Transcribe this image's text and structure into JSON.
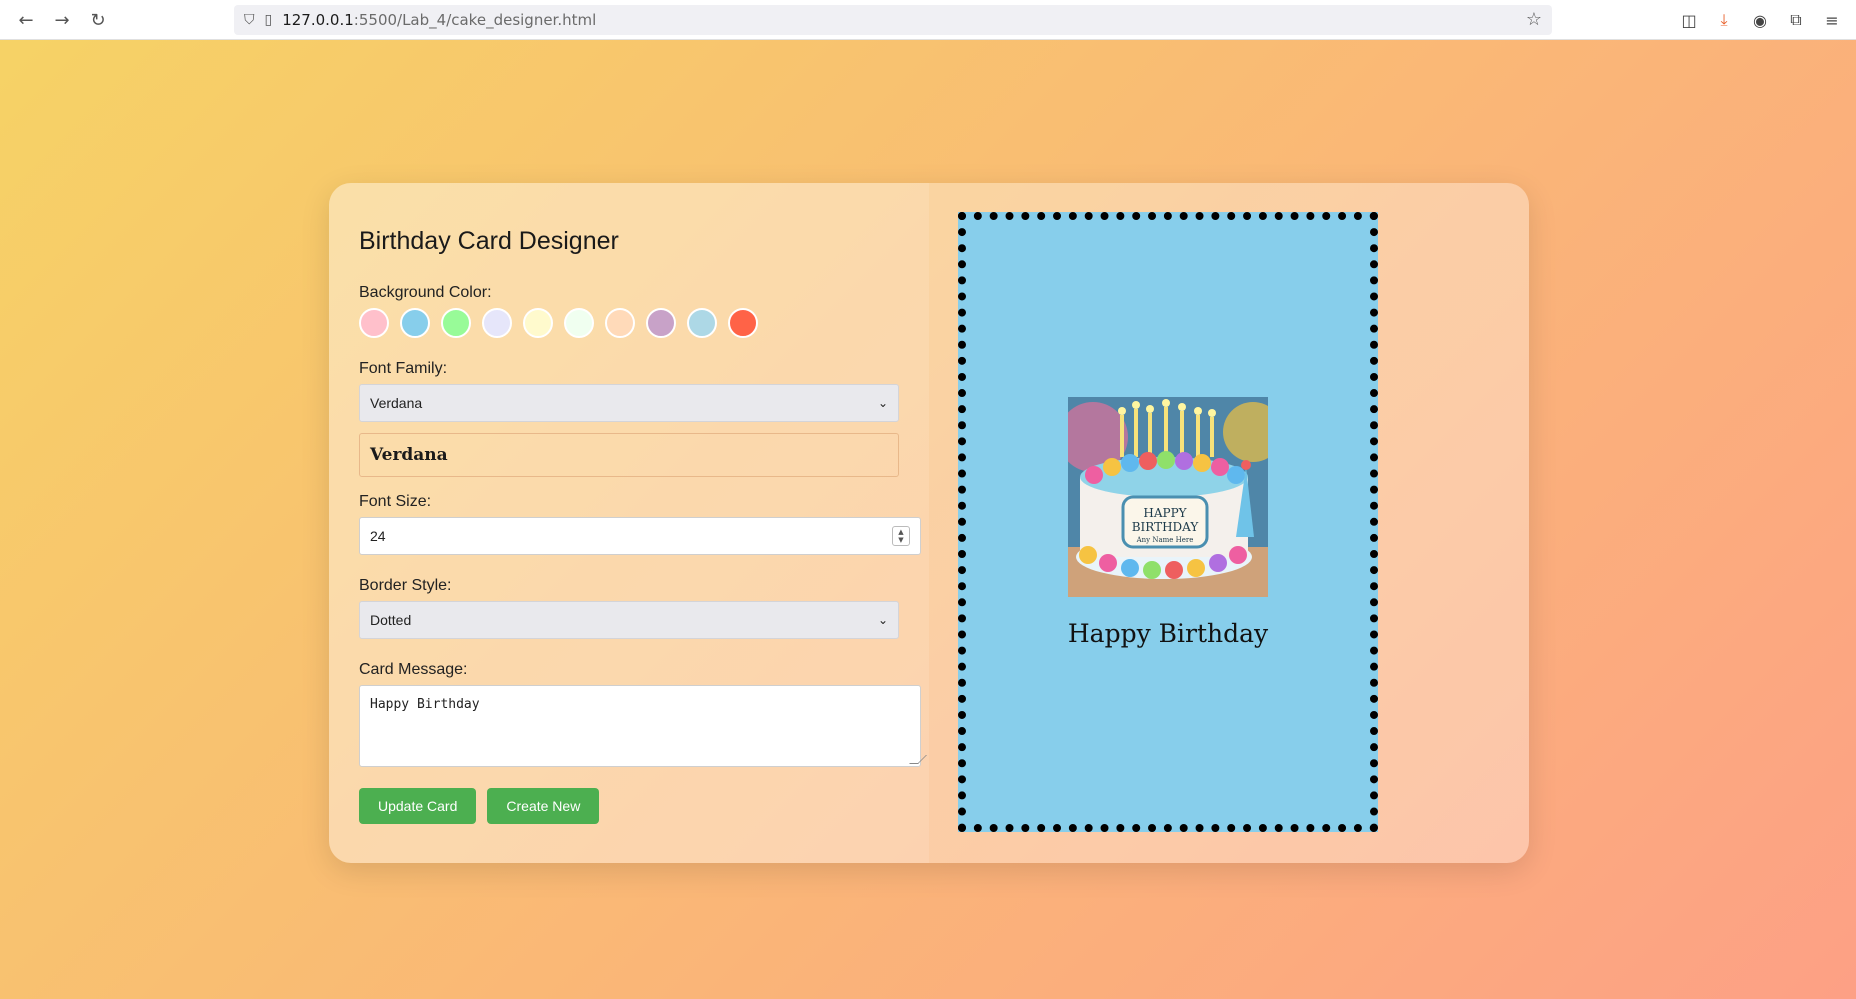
{
  "browser": {
    "url_host": "127.0.0.1",
    "url_path": ":5500/Lab_4/cake_designer.html"
  },
  "designer": {
    "title": "Birthday Card Designer",
    "background_color_label": "Background Color:",
    "swatches": [
      "#ffc0cb",
      "#87ceeb",
      "#98fb98",
      "#e6e6fa",
      "#fffacd",
      "#f0fff0",
      "#ffdab9",
      "#c8a2c8",
      "#add8e6",
      "#ff6347"
    ],
    "font_family_label": "Font Family:",
    "font_family_value": "Verdana",
    "font_preview_text": "Verdana",
    "font_size_label": "Font Size:",
    "font_size_value": "24",
    "border_style_label": "Border Style:",
    "border_style_value": "Dotted",
    "card_message_label": "Card Message:",
    "card_message_value": "Happy Birthday",
    "update_button": "Update Card",
    "create_button": "Create New"
  },
  "card": {
    "background_color": "#87ceeb",
    "border_style": "dotted",
    "image_text_line1": "HAPPY",
    "image_text_line2": "BIRTHDAY",
    "image_text_line3": "Any Name Here",
    "message": "Happy Birthday"
  }
}
